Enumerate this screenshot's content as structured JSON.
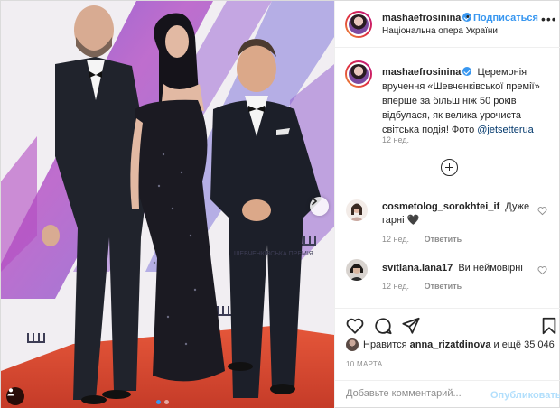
{
  "header": {
    "username": "mashaefrosinina",
    "separator": "•",
    "follow_label": "Подписаться",
    "location": "Національна опера України"
  },
  "caption": {
    "username": "mashaefrosinina",
    "text": "Церемонія вручення «Шевченківської премії» вперше за більш ніж 50 років відбулася, як велика урочиста світська подія! Фото",
    "mention": "@jetsetterua",
    "time": "12 нед."
  },
  "comments": [
    {
      "username": "cosmetolog_sorokhtei_if",
      "text": "Дуже гарні 🖤",
      "time": "12 нед.",
      "reply_label": "Ответить"
    },
    {
      "username": "svitlana.lana17",
      "text": "Ви неймовірні",
      "time": "12 нед.",
      "reply_label": "Ответить"
    }
  ],
  "likes": {
    "prefix": "Нравится",
    "user": "anna_rizatdinova",
    "suffix": "и ещё 35 046"
  },
  "date": "10 МАРТА",
  "comment_input": {
    "placeholder": "Добавьте комментарий..."
  },
  "publish_label": "Опубликовать",
  "photo": {
    "backdrop_text": "ШЕВЧЕНКІВСЬКА ПРЕМІЯ",
    "carousel": {
      "count": 2,
      "active": 1
    }
  },
  "colors": {
    "accent": "#3897f0",
    "carpet": "#d2472f",
    "backdrop_purple": "#8a52c9"
  }
}
